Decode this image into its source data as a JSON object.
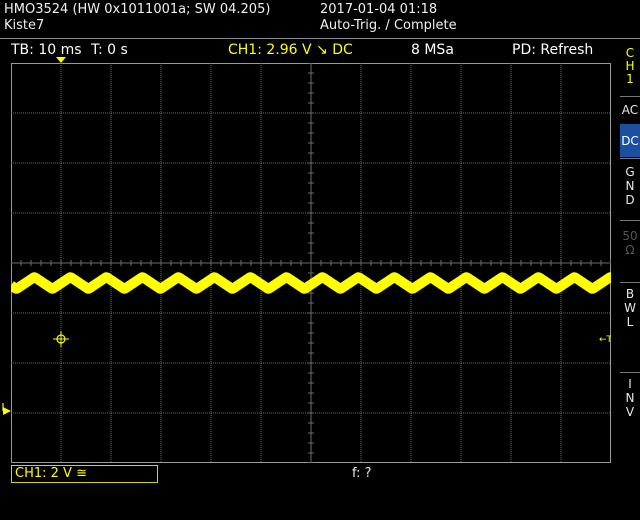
{
  "header": {
    "device": "HMO3524 (HW 0x1011001a; SW 04.205)",
    "name": "Kiste7",
    "datetime": "2017-01-04 01:18",
    "mode": "Auto-Trig. / Complete"
  },
  "status_bar": {
    "timebase": "TB: 10 ms",
    "trigger_time": "T: 0 s",
    "channel": "CH1: 2.96 V ↘ DC",
    "sample_rate": "8 MSa",
    "pd": "PD: Refresh"
  },
  "side_menu": {
    "channel_label": [
      "C",
      "H",
      "1"
    ],
    "ac": "AC",
    "dc": "DC",
    "gnd": [
      "G",
      "N",
      "D"
    ],
    "term": [
      "50",
      "Ω"
    ],
    "bwl": [
      "B",
      "W",
      "L"
    ],
    "inv": [
      "I",
      "N",
      "V"
    ]
  },
  "bottom": {
    "channel_scale": "CH1: 2 V ≅",
    "frequency": "f: ?"
  },
  "colors": {
    "trace": "#ffff00",
    "grid": "#6a6a6a",
    "active_button": "#1b4fa0"
  },
  "waveform": {
    "channel": "CH1",
    "volts_per_div": 2,
    "time_per_div_ms": 10,
    "mean_divisions_below_center": 0.4,
    "ripple_amplitude_div": 0.12,
    "period_div": 0.72
  }
}
